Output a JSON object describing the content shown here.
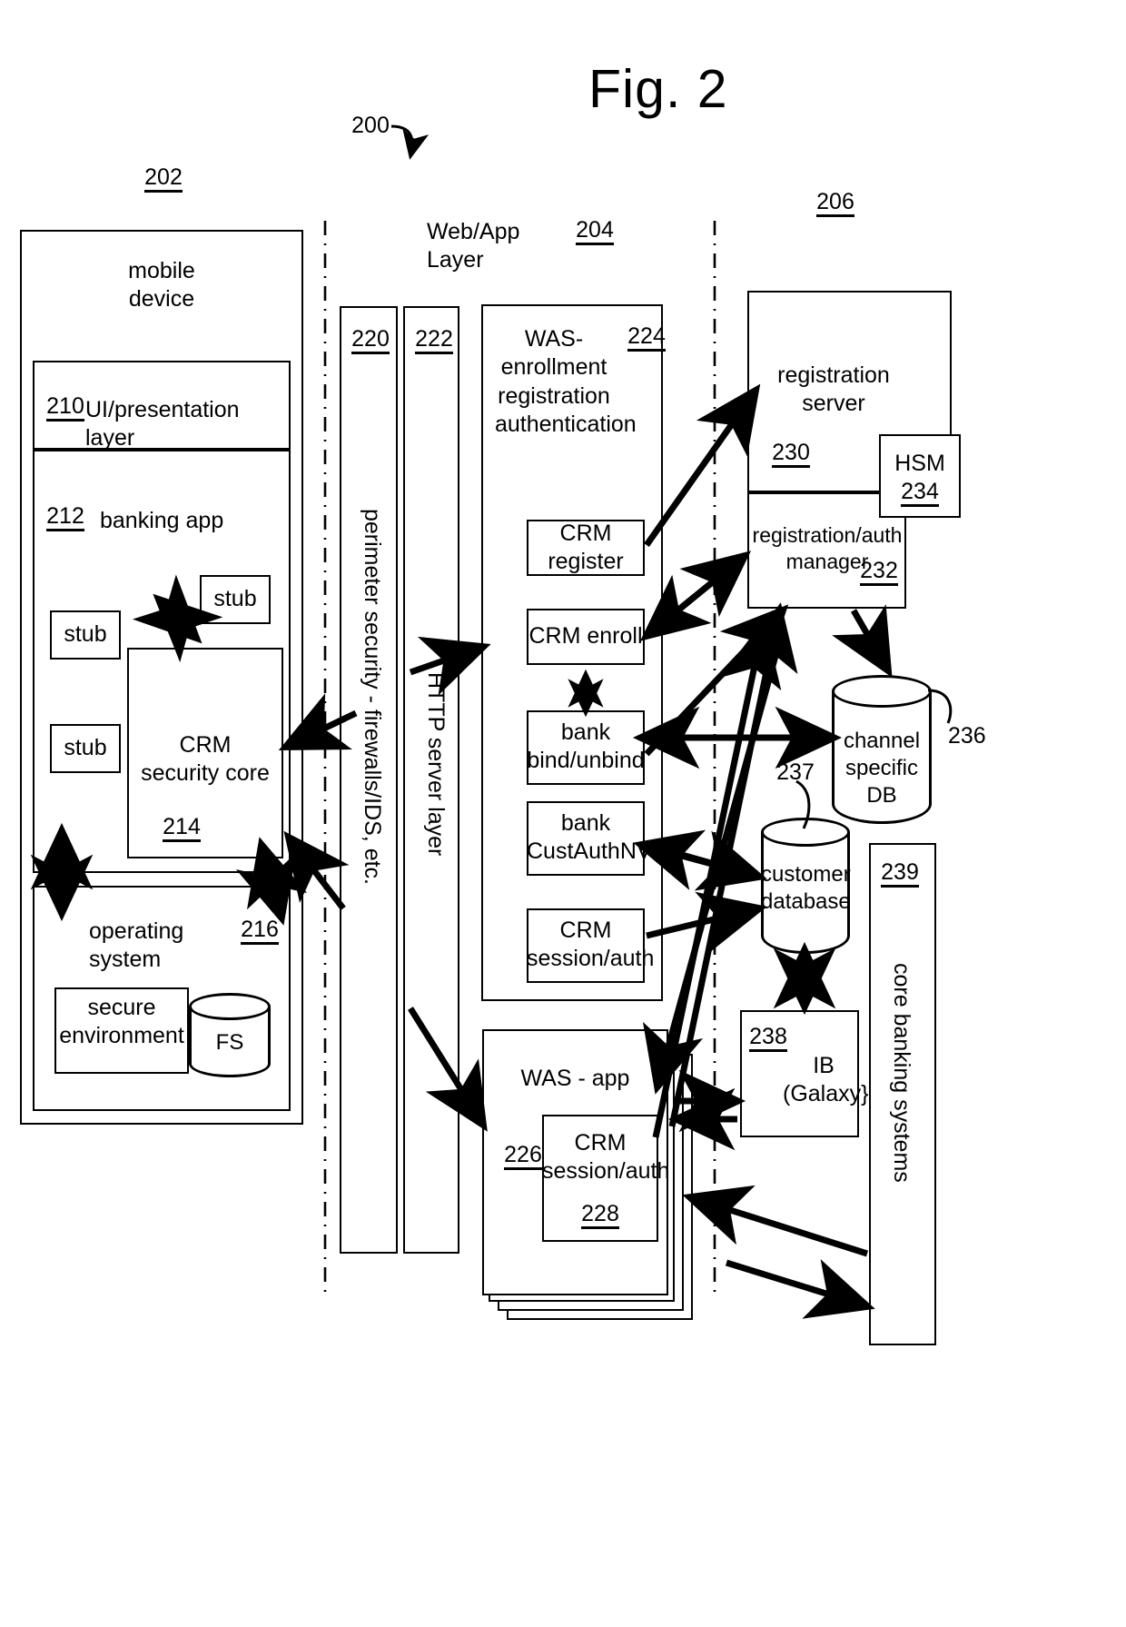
{
  "figure": {
    "title": "Fig. 2",
    "system_ref": "200"
  },
  "columns": {
    "device_ref": "202",
    "web_app_layer_label": "Web/App Layer",
    "web_app_layer_ref": "204",
    "backend_ref": "206"
  },
  "device": {
    "title_line1": "mobile",
    "title_line2": "device",
    "ui_layer": {
      "ref": "210",
      "label": "UI/presentation layer"
    },
    "banking_app": {
      "ref": "212",
      "label": "banking app"
    },
    "stubs": [
      "stub",
      "stub",
      "stub"
    ],
    "security_core": {
      "line1": "CRM",
      "line2": "security core",
      "ref": "214"
    },
    "operating_system": {
      "label": "operating system",
      "ref": "216"
    },
    "secure_environment": {
      "line1": "secure",
      "line2": "environment"
    },
    "fs": {
      "label": "FS"
    }
  },
  "perimeter": {
    "ref": "220",
    "label": "perimeter security - firewalls/IDS, etc."
  },
  "http_server": {
    "ref": "222",
    "label": "HTTP server layer"
  },
  "was_enrollment": {
    "ref": "224",
    "title_line1": "WAS-",
    "title_line2": "enrollment",
    "title_line3": "registration",
    "title_line4": "authentication",
    "items": [
      {
        "label": "CRM register"
      },
      {
        "label": "CRM enroll"
      },
      {
        "line1": "bank",
        "line2": "bind/unbind"
      },
      {
        "line1": "bank",
        "line2": "CustAuthNV"
      },
      {
        "line1": "CRM",
        "line2": "session/auth"
      }
    ]
  },
  "was_app": {
    "title": "WAS - app",
    "ref": "226",
    "inner": {
      "line1": "CRM",
      "line2": "session/auth",
      "ref": "228"
    }
  },
  "registration_server": {
    "title_line1": "registration",
    "title_line2": "server",
    "ref": "230",
    "manager": {
      "line1": "registration/auth",
      "line2": "manager",
      "ref": "232"
    },
    "hsm": {
      "label": "HSM",
      "ref": "234"
    }
  },
  "channel_db": {
    "line1": "channel",
    "line2": "specific DB",
    "ref": "236"
  },
  "customer_db": {
    "line1": "customer",
    "line2": "database",
    "ref": "237"
  },
  "ib": {
    "ref": "238",
    "line1": "IB",
    "line2": "(Galaxy}"
  },
  "core_banking": {
    "ref": "239",
    "label": "core banking systems"
  }
}
